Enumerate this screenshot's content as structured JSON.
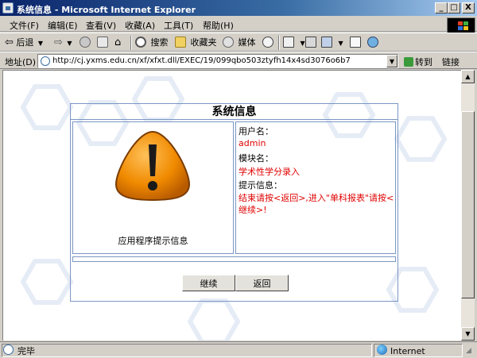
{
  "window": {
    "title": "系统信息 - Microsoft Internet Explorer",
    "minimize": "_",
    "maximize": "□",
    "close": "X"
  },
  "menu": [
    "文件(F)",
    "编辑(E)",
    "查看(V)",
    "收藏(A)",
    "工具(T)",
    "帮助(H)"
  ],
  "toolbar": {
    "back": "后退",
    "search": "搜索",
    "favorites": "收藏夹",
    "media": "媒体"
  },
  "address": {
    "label": "地址(D)",
    "url": "http://cj.yxms.edu.cn/xf/xfxt.dll/EXEC/19/099qbo503ztyfh14x4sd3076o6b7",
    "go": "转到",
    "links": "链接"
  },
  "dialog": {
    "title": "系统信息",
    "caption": "应用程序提示信息",
    "username_label": "用户名：",
    "username_value": "admin",
    "module_label": "模块名：",
    "module_value": "学术性学分录入",
    "hint_label": "提示信息：",
    "hint_value": "结束请按<返回>,进入\"单科报表\"请按<继续>!",
    "continue_label": "继续",
    "back_label": "返回"
  },
  "status": {
    "text": "完毕",
    "zone": "Internet"
  },
  "colors": {
    "title_bar": "#0a246a",
    "value_text": "#e00000",
    "border": "#7a96c4",
    "warning_orange": "#f08a00"
  },
  "icons": {
    "app": "ie-page-icon",
    "warning": "exclamation-warning-icon",
    "zone": "internet-globe-icon"
  }
}
